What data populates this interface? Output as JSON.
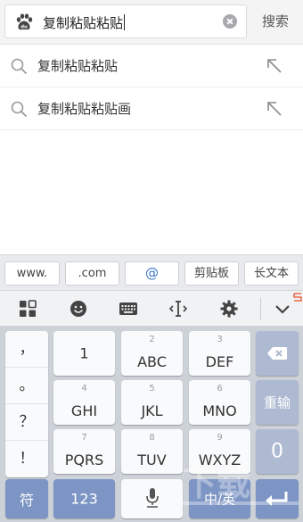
{
  "search": {
    "query": "复制粘贴粘贴",
    "search_button": "搜索"
  },
  "suggestions": [
    {
      "text": "复制粘贴粘贴"
    },
    {
      "text": "复制粘贴粘贴画"
    }
  ],
  "shortcuts": [
    "www.",
    ".com",
    "@",
    "剪贴板",
    "长文本"
  ],
  "toolbar": {
    "icons": [
      "grid-icon",
      "emoji-icon",
      "keyboard-icon",
      "cursor-icon",
      "gear-icon",
      "chevron-down-icon"
    ]
  },
  "keyboard": {
    "punctuation": [
      "，",
      "。",
      "？",
      "！"
    ],
    "rows": [
      [
        {
          "sub": "",
          "main": "1"
        },
        {
          "sub": "2",
          "main": "ABC"
        },
        {
          "sub": "3",
          "main": "DEF"
        }
      ],
      [
        {
          "sub": "4",
          "main": "GHI"
        },
        {
          "sub": "5",
          "main": "JKL"
        },
        {
          "sub": "6",
          "main": "MNO"
        }
      ],
      [
        {
          "sub": "7",
          "main": "PQRS"
        },
        {
          "sub": "8",
          "main": "TUV"
        },
        {
          "sub": "9",
          "main": "WXYZ"
        }
      ]
    ],
    "reinput": "重输",
    "zero": "0",
    "symbol": "符",
    "numbers": "123",
    "language": "中/英"
  },
  "colors": {
    "accent": "#7d95c4",
    "key_bg": "#f9fafb",
    "keyboard_bg": "#cdd1d8",
    "at_color": "#3a74c8"
  }
}
